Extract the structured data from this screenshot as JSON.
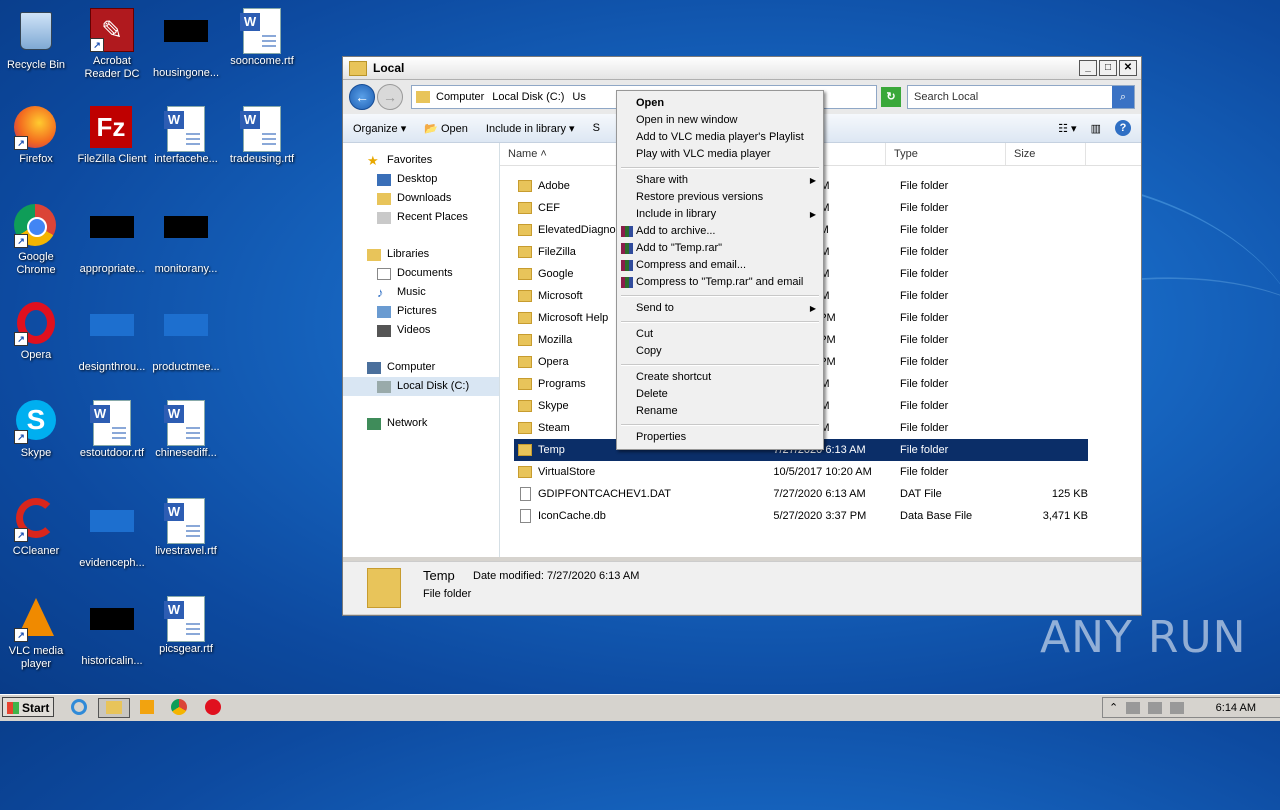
{
  "desktop": {
    "icons": [
      {
        "label": "Recycle Bin"
      },
      {
        "label": "Acrobat Reader DC"
      },
      {
        "label": "housingone..."
      },
      {
        "label": "sooncome.rtf"
      },
      {
        "label": "Firefox"
      },
      {
        "label": "FileZilla Client"
      },
      {
        "label": "interfacehe..."
      },
      {
        "label": "tradeusing.rtf"
      },
      {
        "label": "Google Chrome"
      },
      {
        "label": "appropriate..."
      },
      {
        "label": "monitorany..."
      },
      {
        "label": "Opera"
      },
      {
        "label": "designthrou..."
      },
      {
        "label": "productmee..."
      },
      {
        "label": "Skype"
      },
      {
        "label": "estoutdoor.rtf"
      },
      {
        "label": "chinesediff..."
      },
      {
        "label": "CCleaner"
      },
      {
        "label": "evidenceph..."
      },
      {
        "label": "livestravel.rtf"
      },
      {
        "label": "VLC media player"
      },
      {
        "label": "historicalin..."
      },
      {
        "label": "picsgear.rtf"
      }
    ]
  },
  "window": {
    "title": "Local",
    "breadcrumb": [
      "Computer",
      "Local Disk (C:)",
      "Us"
    ],
    "search_placeholder": "Search Local",
    "toolbar": {
      "organize": "Organize",
      "open": "Open",
      "include": "Include in library",
      "share": "S"
    },
    "nav": {
      "favorites": "Favorites",
      "desktop": "Desktop",
      "downloads": "Downloads",
      "recent": "Recent Places",
      "libraries": "Libraries",
      "documents": "Documents",
      "music": "Music",
      "pictures": "Pictures",
      "videos": "Videos",
      "computer": "Computer",
      "localdisk": "Local Disk (C:)",
      "network": "Network"
    },
    "columns": {
      "name": "Name",
      "date": "dified",
      "type": "Type",
      "size": "Size"
    },
    "files": [
      {
        "name": "Adobe",
        "date": "18 2:54 PM",
        "type": "File folder",
        "size": ""
      },
      {
        "name": "CEF",
        "date": "18 1:19 PM",
        "type": "File folder",
        "size": ""
      },
      {
        "name": "ElevatedDiagno",
        "date": "19 1:11 PM",
        "type": "File folder",
        "size": ""
      },
      {
        "name": "FileZilla",
        "date": "18 1:44 PM",
        "type": "File folder",
        "size": ""
      },
      {
        "name": "Google",
        "date": "19 1:01 PM",
        "type": "File folder",
        "size": ""
      },
      {
        "name": "Microsoft",
        "date": "19 2:00 PM",
        "type": "File folder",
        "size": ""
      },
      {
        "name": "Microsoft Help",
        "date": "18 12:46 PM",
        "type": "File folder",
        "size": ""
      },
      {
        "name": "Mozilla",
        "date": "18 12:06 PM",
        "type": "File folder",
        "size": ""
      },
      {
        "name": "Opera",
        "date": "18 12:46 PM",
        "type": "File folder",
        "size": ""
      },
      {
        "name": "Programs",
        "date": "18 2:06 PM",
        "type": "File folder",
        "size": ""
      },
      {
        "name": "Skype",
        "date": "18 2:13 PM",
        "type": "File folder",
        "size": ""
      },
      {
        "name": "Steam",
        "date": "18 1:19 PM",
        "type": "File folder",
        "size": ""
      },
      {
        "name": "Temp",
        "date": "7/27/2020 6:13 AM",
        "type": "File folder",
        "size": ""
      },
      {
        "name": "VirtualStore",
        "date": "10/5/2017 10:20 AM",
        "type": "File folder",
        "size": ""
      },
      {
        "name": "GDIPFONTCACHEV1.DAT",
        "date": "7/27/2020 6:13 AM",
        "type": "DAT File",
        "size": "125 KB"
      },
      {
        "name": "IconCache.db",
        "date": "5/27/2020 3:37 PM",
        "type": "Data Base File",
        "size": "3,471 KB"
      }
    ],
    "details": {
      "name": "Temp",
      "date_label": "Date modified:",
      "date": "7/27/2020 6:13 AM",
      "type": "File folder"
    }
  },
  "context_menu": {
    "open": "Open",
    "open_new": "Open in new window",
    "vlc_playlist": "Add to VLC media player's Playlist",
    "vlc_play": "Play with VLC media player",
    "share_with": "Share with",
    "restore": "Restore previous versions",
    "include": "Include in library",
    "add_archive": "Add to archive...",
    "add_temp_rar": "Add to \"Temp.rar\"",
    "compress_email": "Compress and email...",
    "compress_temp_email": "Compress to \"Temp.rar\" and email",
    "send_to": "Send to",
    "cut": "Cut",
    "copy": "Copy",
    "create_shortcut": "Create shortcut",
    "delete": "Delete",
    "rename": "Rename",
    "properties": "Properties"
  },
  "taskbar": {
    "start": "Start",
    "clock": "6:14 AM"
  },
  "watermark": "ANY RUN"
}
